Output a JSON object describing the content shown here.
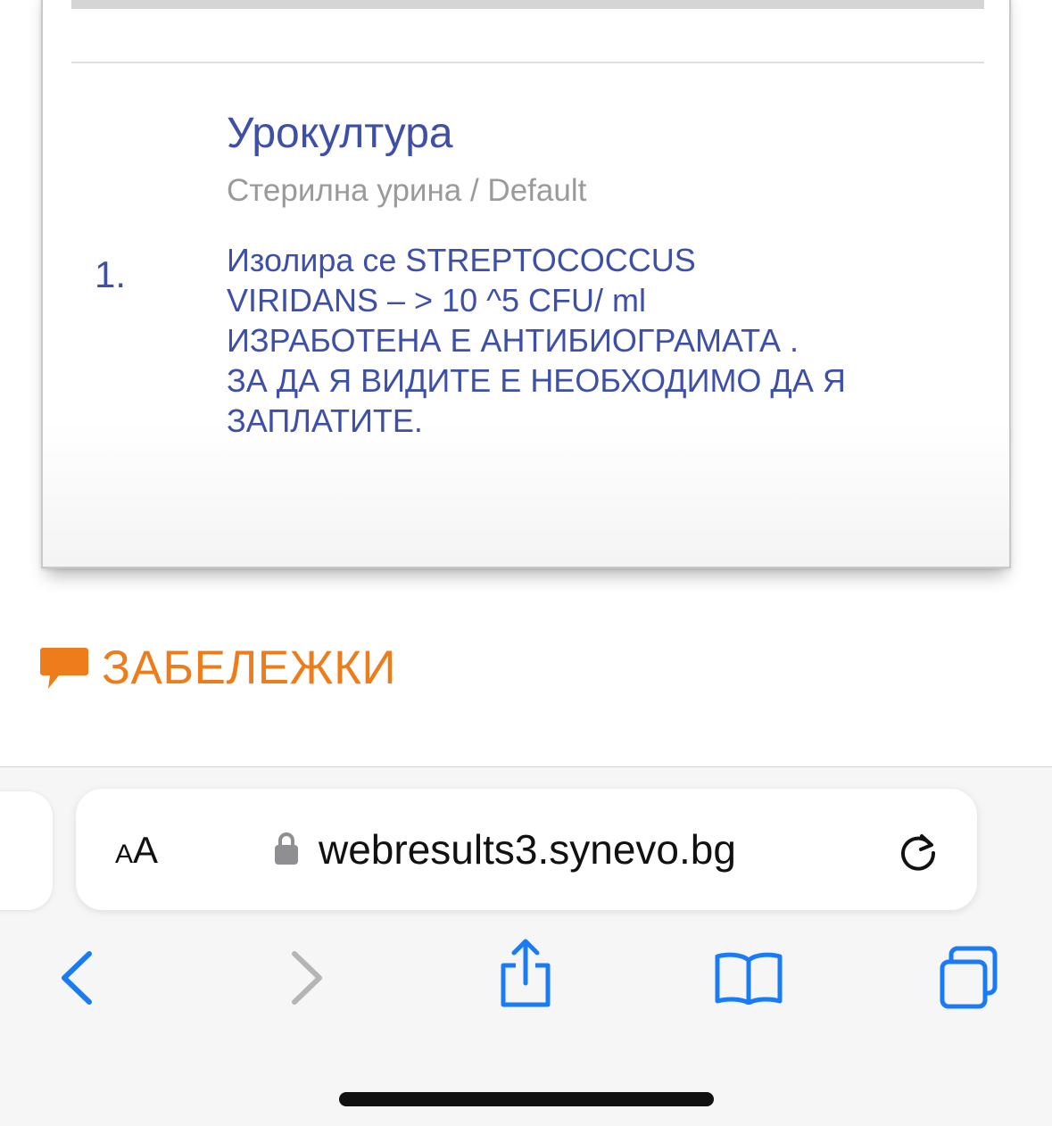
{
  "report": {
    "item_number": "1.",
    "test_title": "Урокултура",
    "test_subtitle": "Стерилна урина / Default",
    "result_lines": [
      "Изолира се STREPTOCOCCUS",
      "VIRIDANS – > 10 ^5 CFU/ ml",
      "ИЗРАБОТЕНА Е АНТИБИОГРАМАТА .",
      "ЗА ДА Я ВИДИТЕ Е НЕОБХОДИМО ДА Я",
      "ЗАПЛАТИТЕ."
    ]
  },
  "notes": {
    "label": "ЗАБЕЛЕЖКИ",
    "icon": "speech-bubble-icon",
    "color": "#ef7c1a"
  },
  "browser": {
    "text_size_small": "A",
    "text_size_large": "A",
    "url": "webresults3.synevo.bg",
    "icons": {
      "lock": "lock-icon",
      "reload": "reload-icon",
      "back": "chevron-left-icon",
      "forward": "chevron-right-icon",
      "share": "share-icon",
      "bookmarks": "book-icon",
      "tabs": "tabs-icon"
    },
    "accent_color": "#1a7cf4",
    "disabled_color": "#b5b5b5"
  },
  "colors": {
    "report_text": "#3d4fa6",
    "subtitle_text": "#9a9a9a"
  }
}
